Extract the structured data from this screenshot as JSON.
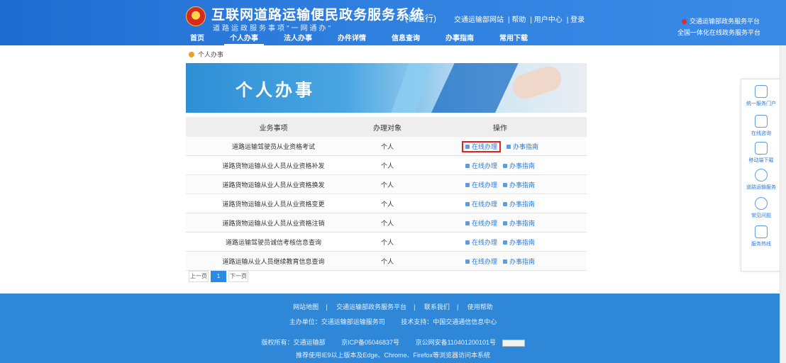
{
  "header": {
    "title": "互联网道路运输便民政务服务系统",
    "trial": "(试运行)",
    "slogan": "道路运政服务事项\"一网通办\"",
    "links": [
      "交通运输部网站",
      "帮助",
      "用户中心",
      "登录"
    ],
    "right_line1": "交通运输部政务服务平台",
    "right_line2": "全国一体化在线政务服务平台"
  },
  "nav": [
    "首页",
    "个人办事",
    "法人办事",
    "办件详情",
    "信息查询",
    "办事指南",
    "常用下载"
  ],
  "breadcrumb": "个人办事",
  "banner": {
    "title": "个人办事"
  },
  "table": {
    "headers": [
      "业务事项",
      "办理对象",
      "操作"
    ],
    "rows": [
      {
        "name": "道路运输驾驶员从业资格考试",
        "target": "个人",
        "action1": "在线办理",
        "action2": "办事指南"
      },
      {
        "name": "道路货物运输从业人员从业资格补发",
        "target": "个人",
        "action1": "在线办理",
        "action2": "办事指南"
      },
      {
        "name": "道路货物运输从业人员从业资格换发",
        "target": "个人",
        "action1": "在线办理",
        "action2": "办事指南"
      },
      {
        "name": "道路货物运输从业人员从业资格变更",
        "target": "个人",
        "action1": "在线办理",
        "action2": "办事指南"
      },
      {
        "name": "道路货物运输从业人员从业资格注销",
        "target": "个人",
        "action1": "在线办理",
        "action2": "办事指南"
      },
      {
        "name": "道路运输驾驶员诚信考核信息查询",
        "target": "个人",
        "action1": "在线办理",
        "action2": "办事指南"
      },
      {
        "name": "道路运输从业人员继续教育信息查询",
        "target": "个人",
        "action1": "在线办理",
        "action2": "办事指南"
      }
    ]
  },
  "pager": {
    "prev": "上一页",
    "current": "1",
    "next": "下一页"
  },
  "float_panel": [
    {
      "icon": "building-icon",
      "label": "统一服务门户"
    },
    {
      "icon": "chat-icon",
      "label": "在线咨询"
    },
    {
      "icon": "phone-icon",
      "label": "移动端下载"
    },
    {
      "icon": "link-icon",
      "label": "道路运输服务"
    },
    {
      "icon": "question-icon",
      "label": "常见问题"
    },
    {
      "icon": "headset-icon",
      "label": "服务热线"
    }
  ],
  "footer": {
    "row1": [
      "网站地图",
      "交通运输部政务服务平台",
      "联系我们",
      "使用帮助"
    ],
    "row2": [
      "主办单位：交通运输部运输服务司",
      "技术支持：中国交通通信信息中心"
    ],
    "row3": [
      "版权所有：交通运输部",
      "京ICP备05046837号",
      "京公网安备110401200101号"
    ],
    "row4": "推荐使用IE9以上版本及Edge、Chrome、Firefox等浏览器访问本系统"
  },
  "colors": {
    "header_blue": "#2f7fe0",
    "footer_blue": "#2f87d8",
    "link_blue": "#2a7bd5",
    "highlight_red": "#e2231a"
  }
}
